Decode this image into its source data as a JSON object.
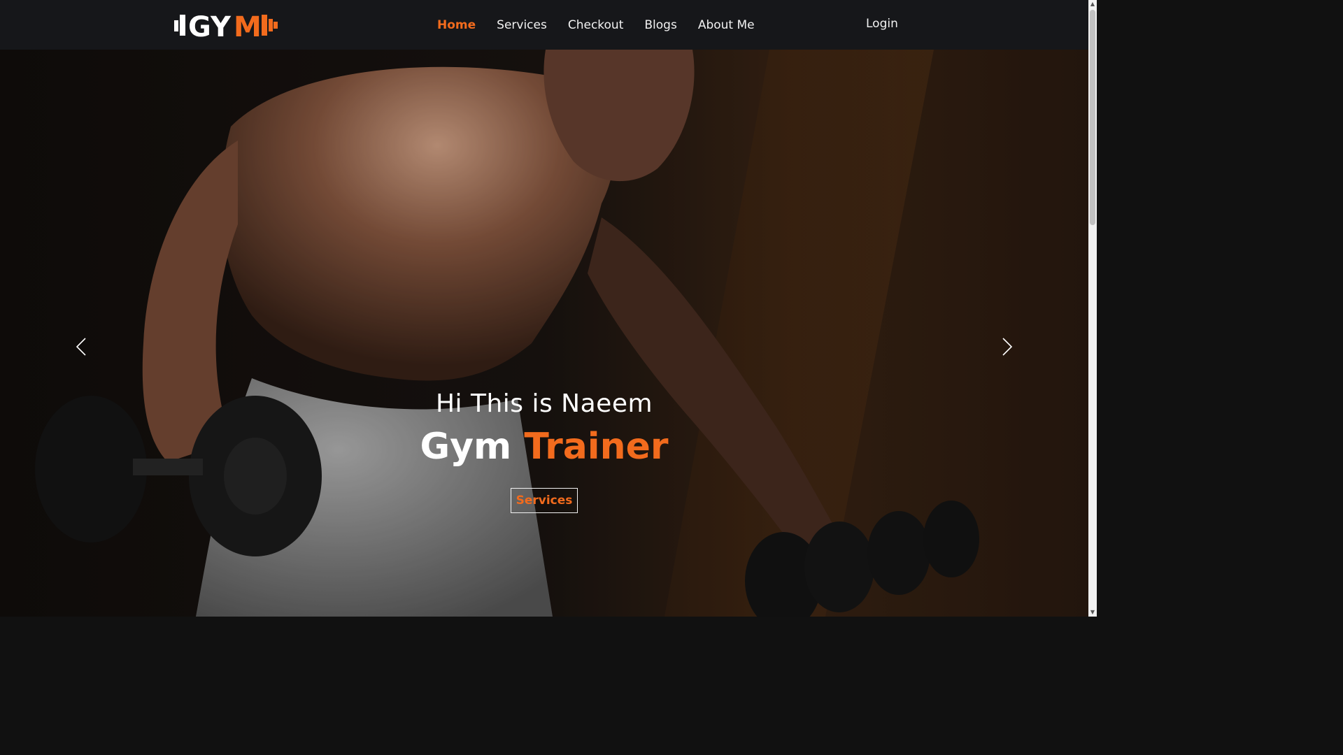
{
  "brand": {
    "logo_text": "GYM"
  },
  "nav": {
    "items": [
      {
        "label": "Home",
        "active": true
      },
      {
        "label": "Services",
        "active": false
      },
      {
        "label": "Checkout",
        "active": false
      },
      {
        "label": "Blogs",
        "active": false
      },
      {
        "label": "About Me",
        "active": false
      }
    ],
    "login_label": "Login"
  },
  "hero": {
    "subtitle": "Hi This is Naeem",
    "title_part1": "Gym ",
    "title_accent": "Trainer",
    "button_label": "Services"
  },
  "icons": {
    "prev": "chevron-left-icon",
    "next": "chevron-right-icon",
    "scroll_up": "triangle-up-icon",
    "scroll_down": "triangle-down-icon"
  },
  "colors": {
    "accent": "#f26b1d",
    "navbar_bg": "#16171a",
    "text": "#f2f2f2"
  }
}
